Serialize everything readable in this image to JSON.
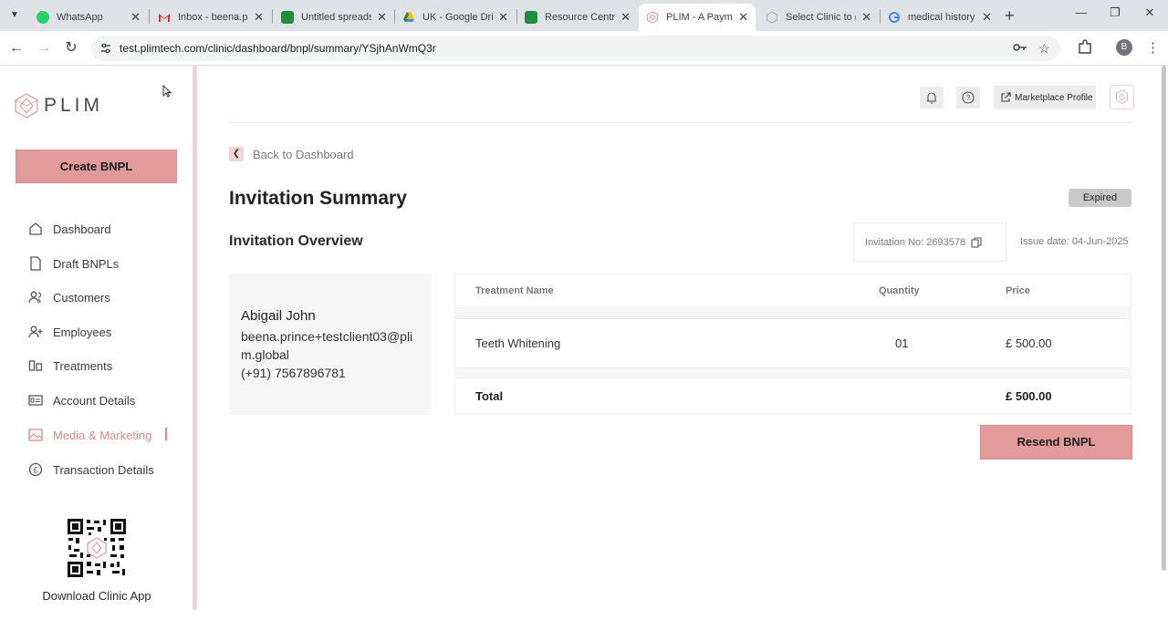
{
  "browser": {
    "tabs": [
      {
        "title": "WhatsApp",
        "icon": "whatsapp-icon",
        "color": "#25d366"
      },
      {
        "title": "Inbox - beena.pr",
        "icon": "gmail-icon",
        "color": "#d93025"
      },
      {
        "title": "Untitled spreads",
        "icon": "sheets-icon",
        "color": "#1e8e3e"
      },
      {
        "title": "UK - Google Driv",
        "icon": "drive-icon",
        "color": "#fbbc04"
      },
      {
        "title": "Resource Centre",
        "icon": "sheets-icon",
        "color": "#1e8e3e"
      },
      {
        "title": "PLIM - A Paymen",
        "icon": "plim-icon",
        "color": "#e39a9a",
        "active": true
      },
      {
        "title": "Select Clinic to c",
        "icon": "loading-icon",
        "color": "#9aa0a6"
      },
      {
        "title": "medical history",
        "icon": "google-icon",
        "color": "#4285f4"
      }
    ],
    "url": "test.plimtech.com/clinic/dashboard/bnpl/summary/YSjhAnWmQ3r",
    "profile_initial": "B"
  },
  "sidebar": {
    "logo_text": "PLIM",
    "create_button": "Create BNPL",
    "items": [
      {
        "label": "Dashboard",
        "icon": "home-icon"
      },
      {
        "label": "Draft BNPLs",
        "icon": "document-icon"
      },
      {
        "label": "Customers",
        "icon": "users-icon"
      },
      {
        "label": "Employees",
        "icon": "user-add-icon"
      },
      {
        "label": "Treatments",
        "icon": "treatments-icon"
      },
      {
        "label": "Account Details",
        "icon": "id-card-icon"
      },
      {
        "label": "Media & Marketing",
        "icon": "image-icon",
        "active": true
      },
      {
        "label": "Transaction Details",
        "icon": "pound-icon"
      }
    ],
    "download_label": "Download Clinic App"
  },
  "header": {
    "marketplace_label": "Marketplace Profile"
  },
  "page": {
    "back_label": "Back to Dashboard",
    "title": "Invitation Summary",
    "status": "Expired",
    "section_title": "Invitation Overview",
    "invitation_no": "Invitation No: 2693578",
    "issue_date": "Issue date: 04-Jun-2025"
  },
  "client": {
    "name": "Abigail John",
    "email": "beena.prince+testclient03@plim.global",
    "phone": "(+91) 7567896781"
  },
  "table": {
    "headers": {
      "name": "Treatment Name",
      "quantity": "Quantity",
      "price": "Price"
    },
    "rows": [
      {
        "name": "Teeth Whitening",
        "quantity": "01",
        "price": "£ 500.00"
      }
    ],
    "total_label": "Total",
    "total_value": "£ 500.00"
  },
  "actions": {
    "resend_button": "Resend BNPL"
  },
  "colors": {
    "brand": "#e39a9a",
    "active_nav": "#d98a8a",
    "badge_bg": "#c9c9c9"
  }
}
